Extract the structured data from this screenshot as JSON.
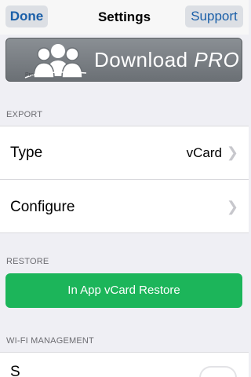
{
  "navbar": {
    "done_label": "Done",
    "title": "Settings",
    "support_label": "Support"
  },
  "banner": {
    "badge_text": "Pro",
    "text_main": "Download ",
    "text_italic": "PRO"
  },
  "sections": {
    "export": "EXPORT",
    "restore": "RESTORE",
    "wifi": "WI-FI MANAGEMENT"
  },
  "export_rows": {
    "type_label": "Type",
    "type_value": "vCard",
    "configure_label": "Configure"
  },
  "restore": {
    "button_label": "In App vCard Restore"
  },
  "wifi_row": {
    "partial_label": "S"
  },
  "colors": {
    "accent": "#1a5fa8",
    "restore_green": "#1cb55a",
    "background": "#efeff4"
  }
}
